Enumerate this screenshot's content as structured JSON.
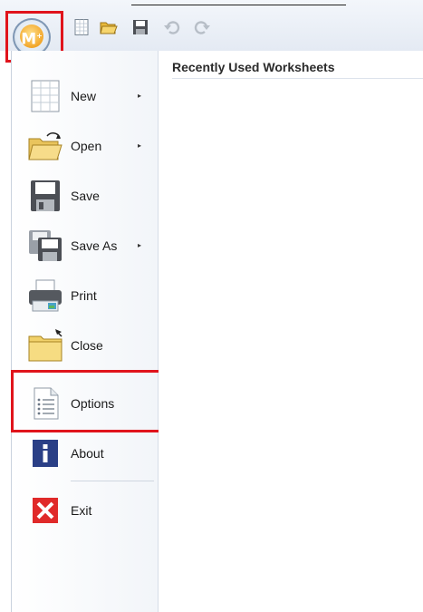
{
  "app": {
    "logo_letter": "M"
  },
  "quick_access": [
    "new-doc-icon",
    "open-folder-icon",
    "save-disk-icon",
    "undo-icon",
    "redo-icon"
  ],
  "menu": {
    "items": [
      {
        "label": "New",
        "icon": "new-worksheet-icon",
        "has_submenu": true
      },
      {
        "label": "Open",
        "icon": "open-folder-icon",
        "has_submenu": true
      },
      {
        "label": "Save",
        "icon": "save-disk-icon",
        "has_submenu": false
      },
      {
        "label": "Save As",
        "icon": "save-as-icon",
        "has_submenu": true
      },
      {
        "label": "Print",
        "icon": "printer-icon",
        "has_submenu": false
      },
      {
        "label": "Close",
        "icon": "close-folder-icon",
        "has_submenu": false
      },
      {
        "label": "Options",
        "icon": "options-list-icon",
        "has_submenu": false
      },
      {
        "label": "About",
        "icon": "info-icon",
        "has_submenu": false
      },
      {
        "label": "Exit",
        "icon": "exit-x-icon",
        "has_submenu": false
      }
    ],
    "submenu_arrow": "▸"
  },
  "recent": {
    "title": "Recently Used Worksheets"
  },
  "colors": {
    "highlight": "#e0141c",
    "accent": "#f2a62a"
  }
}
